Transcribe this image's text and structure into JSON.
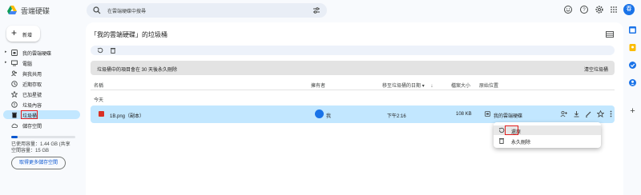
{
  "app": {
    "title": "雲端硬碟"
  },
  "search": {
    "placeholder": "在雲端硬碟中搜尋"
  },
  "header": {
    "avatar_letter": "春"
  },
  "new_button": {
    "label": "新增"
  },
  "sidebar": {
    "items": [
      {
        "label": "我的雲端硬碟",
        "icon": "my-drive-icon",
        "expandable": true
      },
      {
        "label": "電腦",
        "icon": "computer-icon",
        "expandable": true
      },
      {
        "label": "與我共用",
        "icon": "shared-icon",
        "expandable": false
      },
      {
        "label": "近期存取",
        "icon": "recent-icon",
        "expandable": false
      },
      {
        "label": "已加星號",
        "icon": "star-icon",
        "expandable": false
      },
      {
        "label": "垃圾內容",
        "icon": "spam-icon",
        "expandable": false
      },
      {
        "label": "垃圾桶",
        "icon": "trash-icon",
        "expandable": false,
        "active": true
      },
      {
        "label": "儲存空間",
        "icon": "cloud-icon",
        "expandable": false
      }
    ],
    "storage_text": "已使用容量：1.44 GB (共享",
    "storage_total": "空間容量：15 GB",
    "storage_fraction": 0.1,
    "get_more_label": "取得更多儲存空間"
  },
  "main": {
    "title": "「我的雲端硬碟」的垃圾桶",
    "banner_text": "垃圾桶中的項目會在 30 天後永久刪除",
    "banner_button": "清空垃圾桶",
    "columns": [
      "名稱",
      "擁有者",
      "移至垃圾桶的日期",
      "檔案大小",
      "原始位置"
    ],
    "group_label": "今天",
    "row": {
      "name": "1B.png（副本）",
      "owner": "我",
      "date": "下午2:16",
      "size": "108 KB",
      "location": "我的雲端硬碟"
    }
  },
  "context_menu": {
    "items": [
      {
        "label": "還原",
        "icon": "restore-icon"
      },
      {
        "label": "永久刪除",
        "icon": "delete-forever-icon"
      }
    ]
  },
  "colors": {
    "accent": "#0b57d0",
    "selected": "#c2e7ff",
    "highlight_box": "#e01e1e"
  }
}
